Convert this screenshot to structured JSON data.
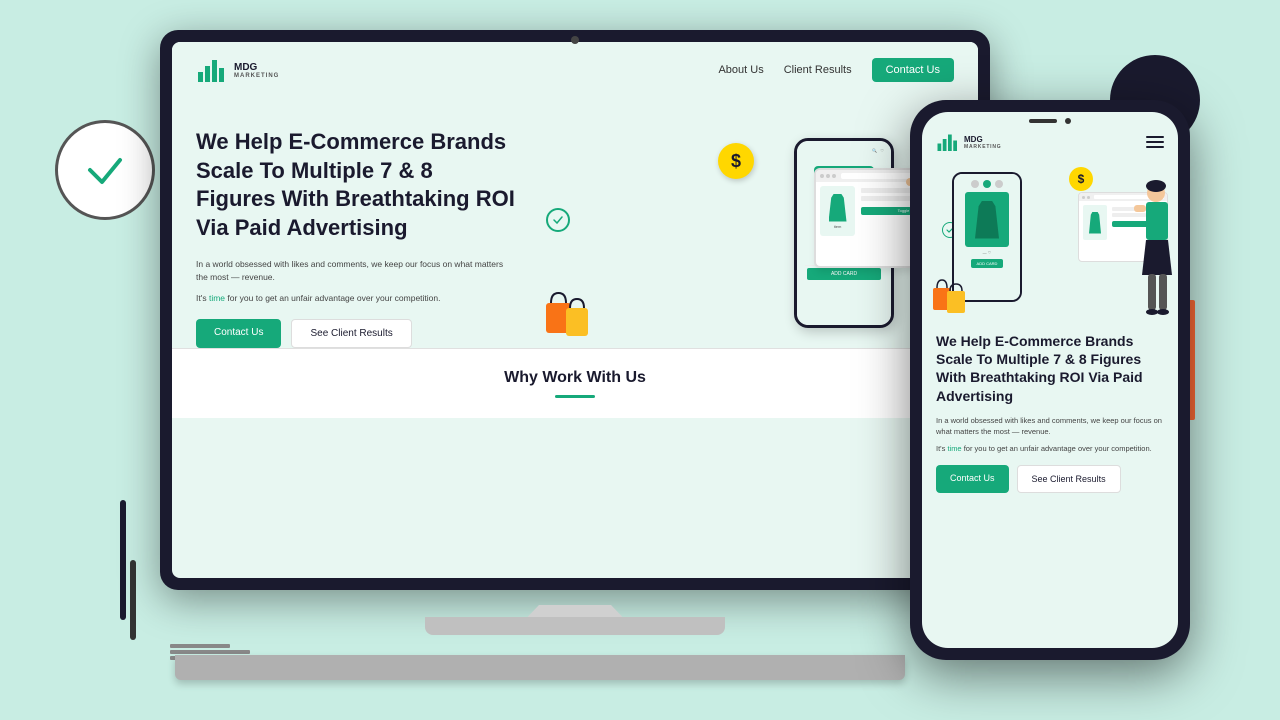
{
  "background_color": "#c8ede3",
  "brand": {
    "logo_text": "MDG",
    "logo_subtitle": "MARKETING"
  },
  "laptop": {
    "nav": {
      "logo": "MDG MARKETING",
      "links": [
        "About Us",
        "Client Results"
      ],
      "cta": "Contact Us"
    },
    "hero": {
      "title": "We Help E-Commerce Brands Scale To Multiple 7 & 8 Figures With Breathtaking ROI Via Paid Advertising",
      "desc1": "In a world obsessed with likes and comments, we keep our focus on what matters the most — revenue.",
      "desc2": "It's time for you to get an unfair advantage over your competition.",
      "btn_primary": "Contact Us",
      "btn_secondary": "See Client Results",
      "dollar_symbol": "$"
    },
    "section": {
      "title": "Why Work With Us"
    }
  },
  "phone": {
    "nav": {
      "logo": "MDG MARKETING",
      "hamburger_label": "menu"
    },
    "hero": {
      "title": "We Help E-Commerce Brands Scale To Multiple 7 & 8 Figures With Breathtaking ROI Via Paid Advertising",
      "desc1": "In a world obsessed with likes and comments, we keep our focus on what matters the most — revenue.",
      "desc2": "It's time for you to get an unfair advantage over your competition.",
      "btn_primary": "Contact Us",
      "btn_secondary": "See Client Results",
      "dollar_symbol": "$"
    },
    "add_card_label": "ADD CARD"
  },
  "decorative": {
    "check_icon": "✓"
  }
}
